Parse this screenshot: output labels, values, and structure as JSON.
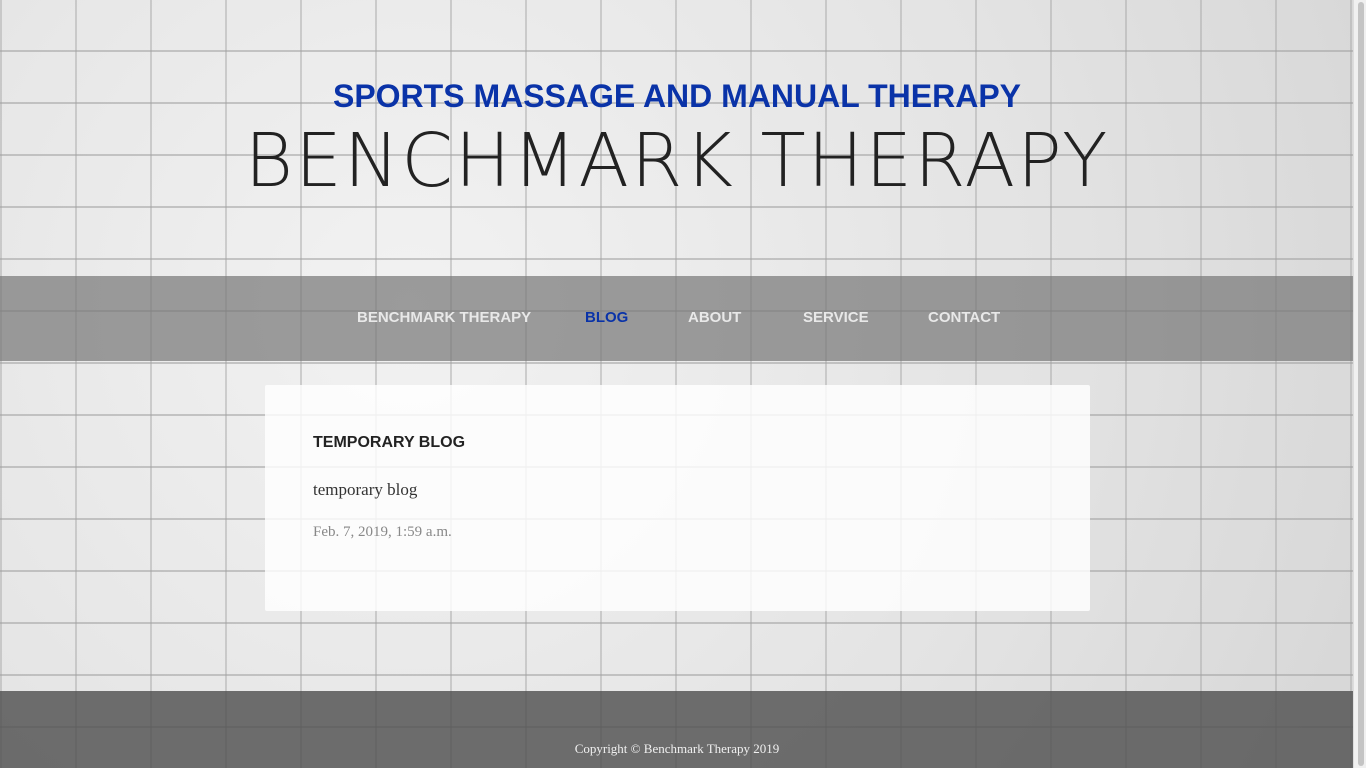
{
  "header": {
    "subtitle": "SPORTS MASSAGE AND MANUAL THERAPY",
    "title": "BENCHMARK THERAPY"
  },
  "nav": {
    "items": [
      {
        "label": "BENCHMARK THERAPY"
      },
      {
        "label": "BLOG"
      },
      {
        "label": "ABOUT"
      },
      {
        "label": "SERVICE"
      },
      {
        "label": "CONTACT"
      }
    ],
    "active": "BLOG"
  },
  "post": {
    "title": "TEMPORARY BLOG",
    "body": "temporary blog",
    "date": "Feb. 7, 2019, 1:59 a.m."
  },
  "footer": {
    "copyright": "Copyright © Benchmark Therapy 2019"
  },
  "colors": {
    "accent": "#0a33a8",
    "nav_background": "#787878",
    "footer_background": "#505050"
  }
}
